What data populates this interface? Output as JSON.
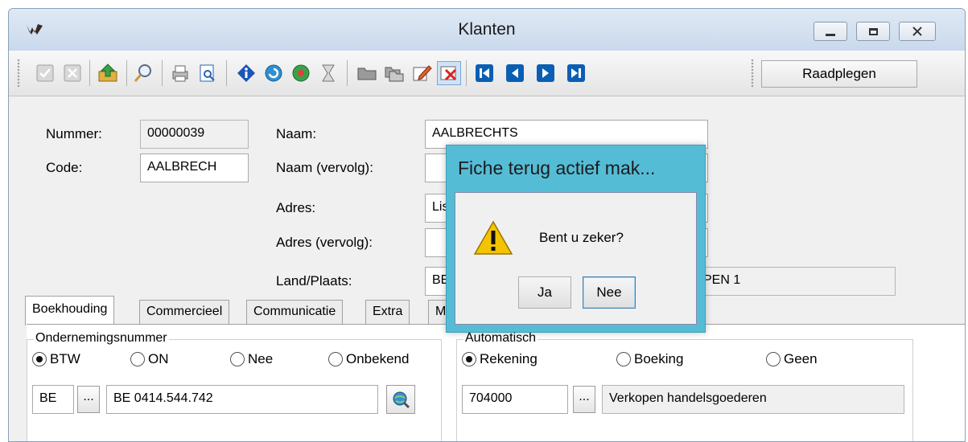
{
  "window": {
    "title": "Klanten",
    "mode": "Raadplegen"
  },
  "icons": {
    "toolbar": [
      "check-icon",
      "close-icon",
      "export-icon",
      "search-icon",
      "print-icon",
      "preview-icon",
      "info-icon",
      "refresh-icon",
      "settings-icon",
      "hourglass-icon",
      "folder-icon",
      "copy-icon",
      "edit-icon",
      "delete-icon",
      "first-record-icon",
      "previous-record-icon",
      "next-record-icon",
      "last-record-icon"
    ]
  },
  "form": {
    "nummer_label": "Nummer:",
    "nummer_value": "00000039",
    "code_label": "Code:",
    "code_value": "AALBRECH",
    "naam_label": "Naam:",
    "naam_value": "AALBRECHTS",
    "naam_vervolg_label": "Naam (vervolg):",
    "naam_vervolg_value": "",
    "adres_label": "Adres:",
    "adres_value": "Lis",
    "adres_vervolg_label": "Adres (vervolg):",
    "adres_vervolg_value": "",
    "land_plaats_label": "Land/Plaats:",
    "land_value": "BE",
    "plaats_value": "PEN 1"
  },
  "tabs": [
    "Boekhouding",
    "Commercieel",
    "Communicatie",
    "Extra",
    "M"
  ],
  "boekhouding": {
    "ondernemingsnummer_title": "Ondernemingsnummer",
    "radio_btw": "BTW",
    "radio_on": "ON",
    "radio_nee": "Nee",
    "radio_onbekend": "Onbekend",
    "country": "BE",
    "ellipsis": "...",
    "vat_number": "BE 0414.544.742",
    "automatisch_title": "Automatisch",
    "radio_rekening": "Rekening",
    "radio_boeking": "Boeking",
    "radio_geen": "Geen",
    "account": "704000",
    "account_desc": "Verkopen handelsgoederen"
  },
  "dialog": {
    "title": "Fiche terug actief mak...",
    "message": "Bent u zeker?",
    "yes": "Ja",
    "no": "Nee"
  },
  "colors": {
    "dialog_frame": "#55bcd6",
    "nav_blue": "#0a5fb4"
  }
}
